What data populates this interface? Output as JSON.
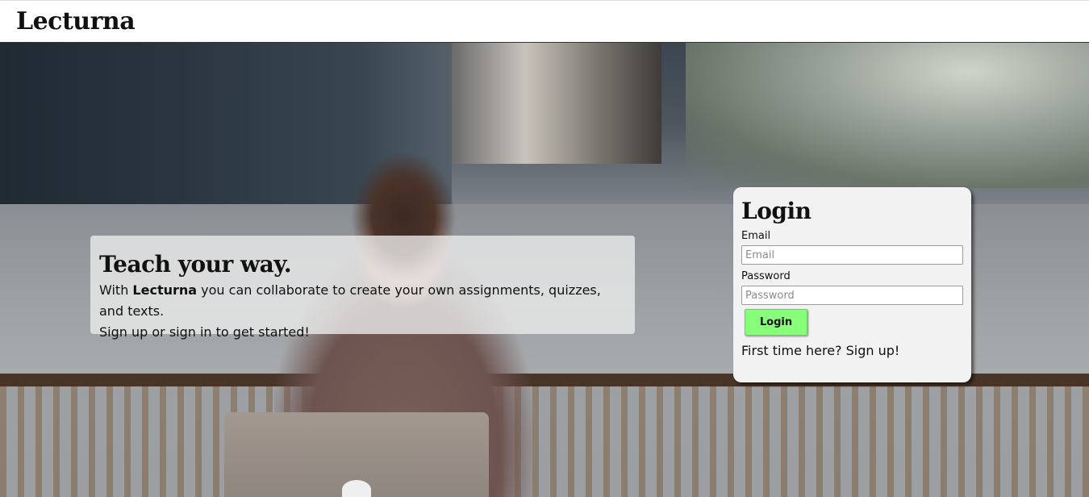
{
  "navbar": {
    "brand": "Lecturna"
  },
  "intro": {
    "heading": "Teach your way.",
    "line1_prefix": "With ",
    "line1_brand": "Lecturna",
    "line1_suffix": " you can collaborate to create your own assignments, quizzes, and texts.",
    "line2": "Sign up or sign in to get started!"
  },
  "login": {
    "title": "Login",
    "email_label": "Email",
    "email_placeholder": "Email",
    "email_value": "",
    "password_label": "Password",
    "password_placeholder": "Password",
    "password_value": "",
    "button_label": "Login",
    "signup_prompt": "First time here? ",
    "signup_link": "Sign up!"
  },
  "colors": {
    "login_button": "#88ff7a",
    "card_background": "#f2f2f2",
    "intro_background": "rgba(235,235,235,0.8)"
  }
}
